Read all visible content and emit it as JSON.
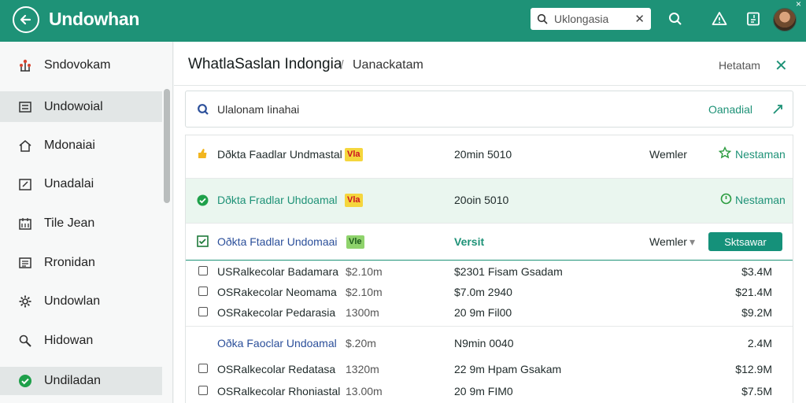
{
  "app": {
    "title": "Undowhan",
    "search_value": "Uklongasia",
    "window_close": "×"
  },
  "colors": {
    "brand": "#1e9277",
    "accent_text": "#1e9277",
    "highlight_row": "#eaf6ef",
    "tag_yellow": "#f5d63d",
    "tag_green": "#8fd36c"
  },
  "header_icons": [
    "back-arrow-icon",
    "search-icon",
    "alert-triangle-icon",
    "document-icon",
    "user-avatar"
  ],
  "sidebar": {
    "items": [
      {
        "label": "Sndovokam",
        "icon": "tree-icon"
      },
      {
        "label": "Undowoial",
        "icon": "list-icon"
      },
      {
        "label": "Mdonaiai",
        "icon": "home-icon"
      },
      {
        "label": "Unadalai",
        "icon": "edit-icon"
      },
      {
        "label": "Tile Jean",
        "icon": "calendar-icon"
      },
      {
        "label": "Rronidan",
        "icon": "table-icon"
      },
      {
        "label": "Undowlan",
        "icon": "gear-icon"
      },
      {
        "label": "Hidowan",
        "icon": "tools-icon"
      },
      {
        "label": "Undiladan",
        "icon": "check-circle-icon"
      }
    ]
  },
  "breadcrumb": {
    "title": "WhatlaSaslan Indongia",
    "separator": "/",
    "current": "Uanackatam",
    "right_text": "Hetatam"
  },
  "filter": {
    "text": "Ulalonam Iinahai",
    "action": "Oanadial"
  },
  "rows": [
    {
      "name": "Dðkta Faadlar Undmastal",
      "tag": "Vla",
      "date": "20min 5010",
      "col4": "Wemler",
      "action": "Nestaman"
    },
    {
      "name": "Dðkta Fradlar Uhdoamal",
      "tag": "Vla",
      "date": "20oin 5010",
      "action": "Nestaman"
    },
    {
      "name": "Oðkta Ftadlar Undomaai",
      "tag": "Vle",
      "date": "Versit",
      "col4": "Wemler",
      "action": "Sktsawar"
    }
  ],
  "sub_rows": [
    {
      "name": "USRalkecolar Badamara",
      "amount": "$2.10m",
      "detail": "$2301 Fisam Gsadam",
      "total": "$3.4M"
    },
    {
      "name": "OSRakecolar Neomama",
      "amount": "$2.10m",
      "detail": "$7.0m 2940",
      "total": "$21.4M"
    },
    {
      "name": "OSRakecolar Pedarasia",
      "amount": "1300m",
      "detail": "20 9m Fil00",
      "total": "$9.2M"
    },
    {
      "name": "Oðka Faoclar Undoamal",
      "amount": "$.20m",
      "detail": "N9min 0040",
      "total": "2.4M"
    },
    {
      "name": "OSRalkecolar Redatasa",
      "amount": "1320m",
      "detail": "22 9m Hpam Gsakam",
      "total": "$12.9M"
    },
    {
      "name": "OSRalkecolar Rhoniastal",
      "amount": "13.00m",
      "detail": "20 9m FIM0",
      "total": "$7.5M"
    }
  ]
}
